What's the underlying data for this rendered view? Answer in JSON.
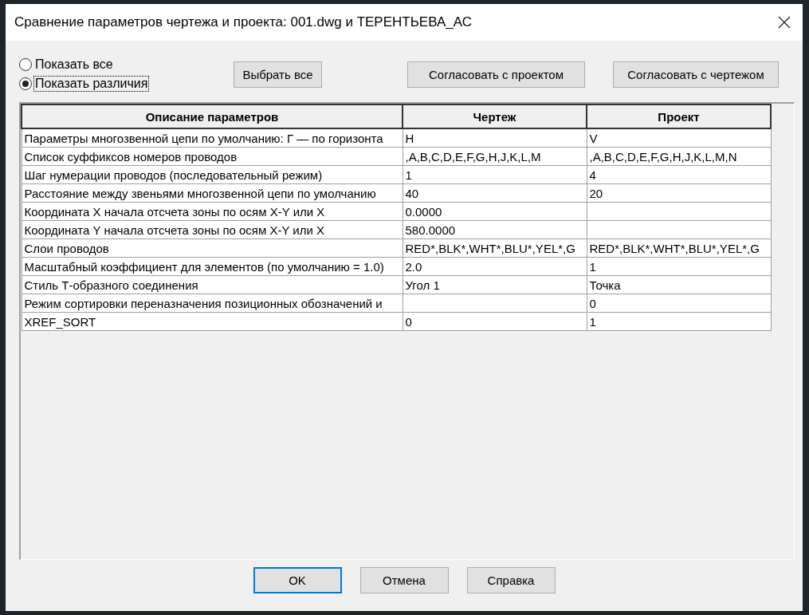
{
  "window": {
    "title": "Сравнение параметров чертежа и проекта: 001.dwg и ТЕРЕНТЬЕВА_АС"
  },
  "view_options": [
    {
      "label": "Показать все",
      "selected": false,
      "focused": false
    },
    {
      "label": "Показать различия",
      "selected": true,
      "focused": true
    }
  ],
  "toolbar_buttons": [
    "Выбрать все",
    "Согласовать с проектом",
    "Согласовать с чертежом"
  ],
  "table": {
    "columns": [
      "Описание параметров",
      "Чертеж",
      "Проект"
    ],
    "rows": [
      {
        "description": "Параметры многозвенной цепи по умолчанию: Г — по горизонта",
        "drawing": "H",
        "project": "V"
      },
      {
        "description": "Список суффиксов номеров проводов",
        "drawing": ",A,B,C,D,E,F,G,H,J,K,L,M",
        "project": ",A,B,C,D,E,F,G,H,J,K,L,M,N"
      },
      {
        "description": "Шаг нумерации проводов (последовательный режим)",
        "drawing": "1",
        "project": "4"
      },
      {
        "description": "Расстояние между звеньями многозвенной цепи по умолчанию",
        "drawing": "40",
        "project": "20"
      },
      {
        "description": "Координата X начала отсчета зоны по осям X-Y или X",
        "drawing": "0.0000"
      },
      {
        "description": "Координата Y начала отсчета зоны по осям X-Y или X",
        "drawing": "580.0000"
      },
      {
        "description": "Слои проводов",
        "drawing": "RED*,BLK*,WHT*,BLU*,YEL*,G",
        "project": "RED*,BLK*,WHT*,BLU*,YEL*,G"
      },
      {
        "description": "Масштабный коэффициент для элементов (по умолчанию = 1.0)",
        "drawing": "2.0",
        "project": "1"
      },
      {
        "description": "Стиль Т-образного соединения",
        "drawing": "Угол 1",
        "project": "Точка"
      },
      {
        "description": "Режим сортировки переназначения позиционных обозначений и",
        "project": "0"
      },
      {
        "description": "XREF_SORT",
        "drawing": "0",
        "project": "1"
      }
    ]
  },
  "footer_buttons": [
    {
      "label": "OK",
      "default": true
    },
    {
      "label": "Отмена",
      "default": false
    },
    {
      "label": "Справка",
      "default": false
    }
  ]
}
